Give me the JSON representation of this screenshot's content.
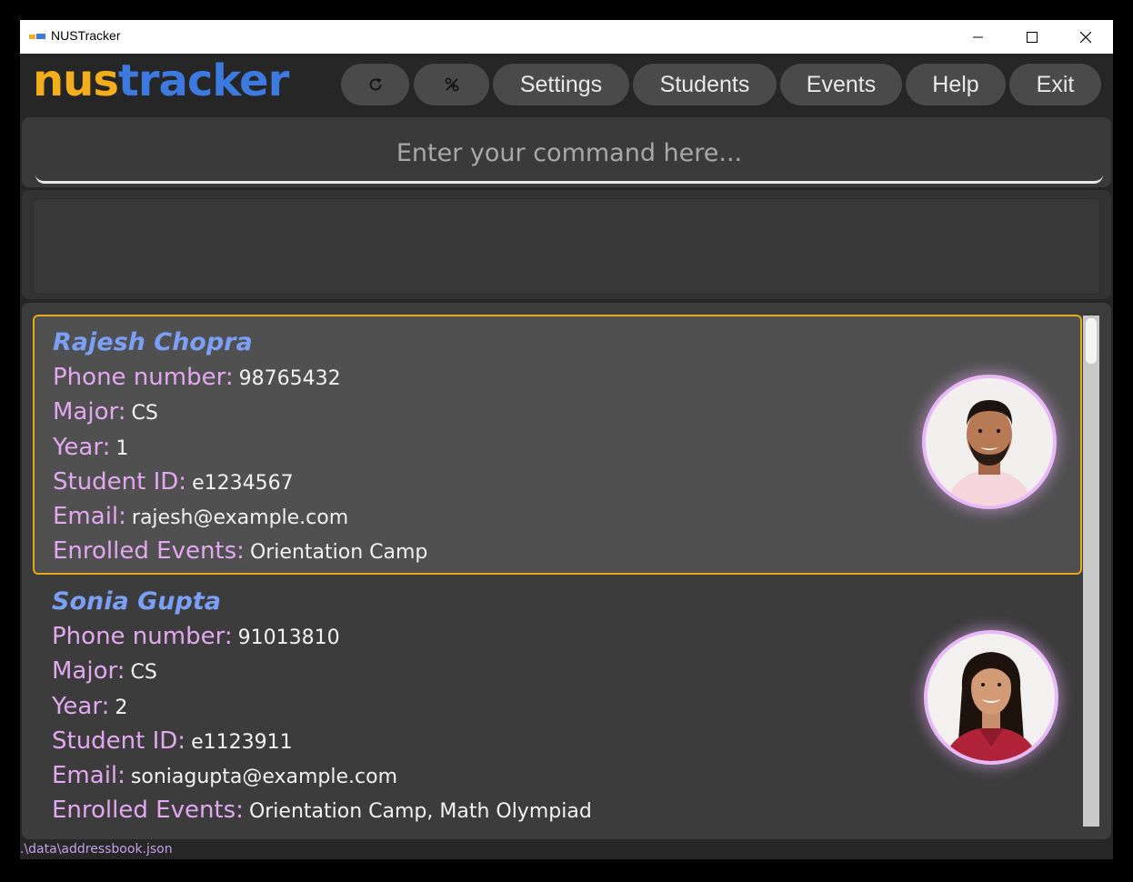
{
  "window": {
    "title": "NUSTracker"
  },
  "header": {
    "logo_part1": "nus",
    "logo_part2": "tracker",
    "buttons": {
      "refresh_icon": "refresh-icon",
      "theme_icon": "theme-toggle-icon",
      "settings": "Settings",
      "students": "Students",
      "events": "Events",
      "help": "Help",
      "exit": "Exit"
    }
  },
  "command": {
    "placeholder": "Enter your command here...",
    "value": ""
  },
  "result": {
    "text": ""
  },
  "labels": {
    "phone": "Phone number:",
    "major": "Major:",
    "year": "Year:",
    "student_id": "Student ID:",
    "email": "Email:",
    "events": "Enrolled Events:"
  },
  "students": [
    {
      "name": "Rajesh Chopra",
      "phone": "98765432",
      "major": "CS",
      "year": "1",
      "student_id": "e1234567",
      "email": "rajesh@example.com",
      "events": "Orientation Camp",
      "selected": true
    },
    {
      "name": "Sonia Gupta",
      "phone": "91013810",
      "major": "CS",
      "year": "2",
      "student_id": "e1123911",
      "email": "soniagupta@example.com",
      "events": "Orientation Camp, Math Olympiad",
      "selected": false
    }
  ],
  "status": {
    "file_path": ".\\data\\addressbook.json"
  },
  "colors": {
    "logo_nus": "#f4ad1b",
    "logo_tracker": "#3d7ae0",
    "name": "#7b9ff5",
    "label": "#e2a8f0",
    "selected_border": "#e8a817",
    "avatar_ring": "#e9b8f7"
  }
}
